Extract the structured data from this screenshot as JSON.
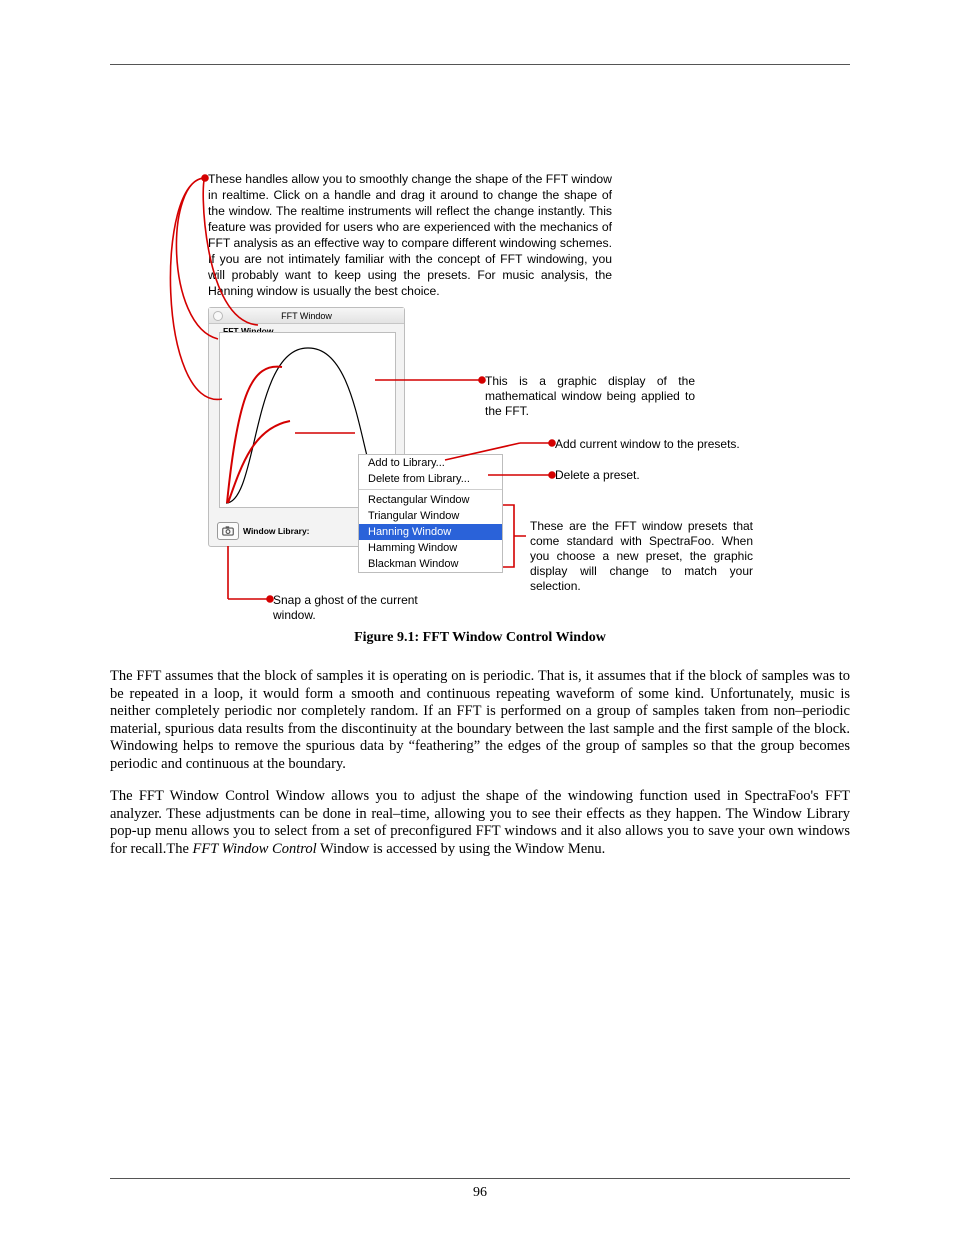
{
  "top_note": "These handles allow you to smoothly change the shape of the FFT window in realtime. Click on a handle and drag it around to change the shape of the window. The realtime instruments will reflect the change instantly. This feature was provided for users who are experienced with the mechanics of FFT analysis as an effective way to compare different windowing schemes. If you are not intimately familiar with the concept of FFT windowing, you will probably want to keep using the presets. For music analysis, the Hanning window is usually the best choice.",
  "fft_window": {
    "title": "FFT Window",
    "inner_label": "FFT Window",
    "bottom_label": "Window Library:"
  },
  "menu": {
    "add": "Add to Library...",
    "del": "Delete from Library...",
    "rect": "Rectangular Window",
    "tri": "Triangular Window",
    "hann": "Hanning Window",
    "hamm": "Hamming Window",
    "black": "Blackman Window"
  },
  "callouts": {
    "graphic": "This is a graphic display of the mathematical window being applied to the FFT.",
    "add": "Add current window to the presets.",
    "del": "Delete a preset.",
    "presets": "These are the FFT window presets that come standard with SpectraFoo. When you choose a new preset, the graphic display will change to match your selection.",
    "snap": "Snap a ghost of the current window."
  },
  "caption": "Figure 9.1: FFT Window Control Window",
  "para1": "The FFT assumes that the block of samples it is operating on is periodic. That is, it assumes that if the block of samples was to be repeated in a loop, it would form a smooth and continuous repeating waveform of some kind. Unfortunately, music is neither completely periodic nor completely random. If an FFT is performed on a group of samples taken from non–periodic material, spurious data results from the discontinuity at the boundary between the last sample and the first sample of the block. Windowing helps to remove the spurious data by “feathering” the edges of the group of samples so that the group becomes periodic and continuous at the boundary.",
  "para2_a": "The FFT Window Control Window allows you to adjust the shape of the windowing function used in SpectraFoo's FFT analyzer. These adjustments can be done in real–time, allowing you to see their effects as they happen. The Window Library pop-up menu allows you to select from a set of preconfigured FFT windows and it also allows you to save your own windows for recall.The ",
  "para2_em": "FFT Window Control",
  "para2_b": " Window is accessed by using the Window Menu.",
  "pagenum": "96"
}
